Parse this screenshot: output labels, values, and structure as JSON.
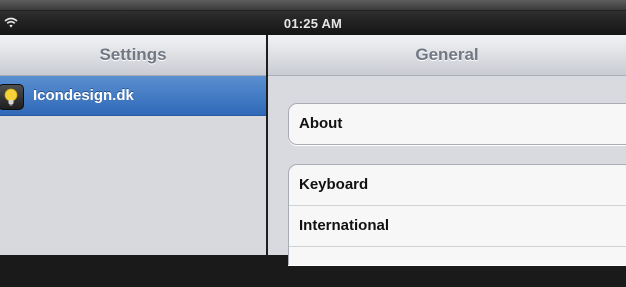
{
  "status_bar": {
    "time": "01:25 AM",
    "wifi_icon": "wifi-icon"
  },
  "sidebar": {
    "title": "Settings",
    "items": [
      {
        "label": "Icondesign.dk",
        "icon": "lightbulb-icon",
        "selected": true
      }
    ]
  },
  "detail": {
    "title": "General",
    "groups": [
      {
        "cells": [
          {
            "label": "About"
          }
        ]
      },
      {
        "cells": [
          {
            "label": "Keyboard"
          },
          {
            "label": "International"
          }
        ]
      }
    ]
  },
  "colors": {
    "selection": "#3a74c2",
    "navbar_text": "#717884",
    "background": "#d8dadf"
  }
}
